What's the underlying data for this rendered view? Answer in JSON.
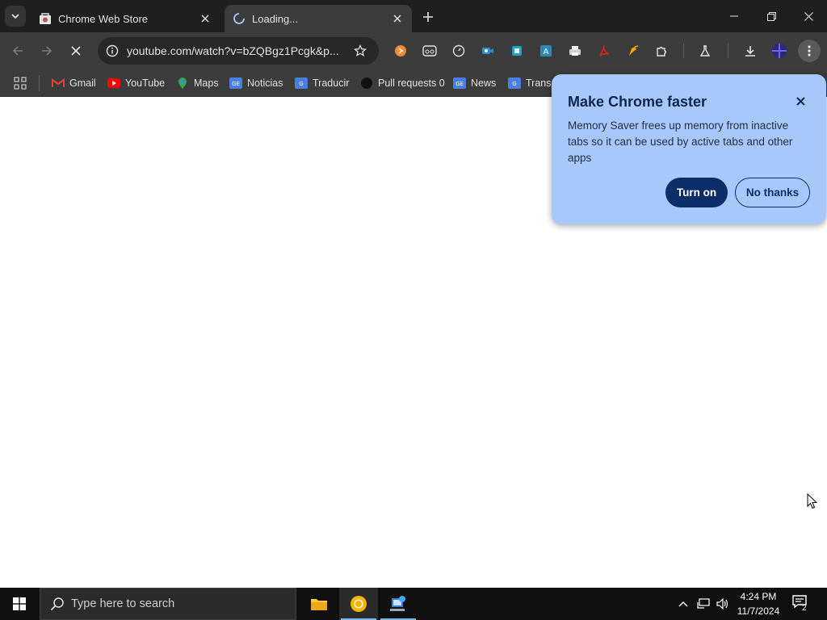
{
  "tabs": [
    {
      "title": "Chrome Web Store",
      "active": false
    },
    {
      "title": "Loading...",
      "active": true
    }
  ],
  "omnibox": {
    "url": "youtube.com/watch?v=bZQBgz1Pcgk&p..."
  },
  "bookmarks": [
    {
      "label": "Gmail",
      "icon": "gmail-icon"
    },
    {
      "label": "YouTube",
      "icon": "youtube-icon"
    },
    {
      "label": "Maps",
      "icon": "maps-icon"
    },
    {
      "label": "Noticias",
      "icon": "news-icon"
    },
    {
      "label": "Traducir",
      "icon": "translate-icon"
    },
    {
      "label": "Pull requests 0",
      "icon": "github-icon"
    },
    {
      "label": "News",
      "icon": "news-icon"
    },
    {
      "label": "Transl",
      "icon": "translate-icon"
    }
  ],
  "popup": {
    "title": "Make Chrome faster",
    "body": "Memory Saver frees up memory from inactive tabs so it can be used by active tabs and other apps",
    "primary_label": "Turn on",
    "secondary_label": "No thanks"
  },
  "taskbar": {
    "search_placeholder": "Type here to search",
    "time": "4:24 PM",
    "date": "11/7/2024",
    "notification_count": "2"
  },
  "colors": {
    "popup_bg": "#a8c7fa",
    "popup_primary_button": "#0b2e6b",
    "toolbar_bg": "#3c3c3c",
    "tabstrip_bg": "#1f1f1f"
  }
}
